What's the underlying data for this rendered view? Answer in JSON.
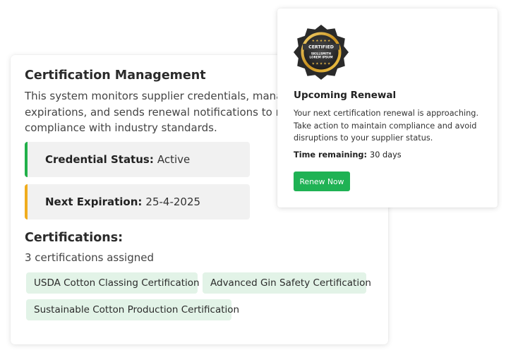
{
  "main": {
    "title": "Certification Management",
    "description_lines": [
      "This system monitors supplier credentials, manages",
      "expirations, and sends renewal notifications to mai",
      "compliance with industry standards."
    ],
    "status": {
      "label": "Credential Status:",
      "value": "Active",
      "accent_color": "#22b04a"
    },
    "expiration": {
      "label": "Next Expiration:",
      "value": "25-4-2025",
      "accent_color": "#f0ad1e"
    },
    "certifications": {
      "heading": "Certifications:",
      "count_text": "3 certifications assigned",
      "tags": [
        "USDA Cotton Classing Certification",
        "Advanced Gin Safety Certification",
        "Sustainable Cotton Production Certification"
      ],
      "tag_color": "#e2f3e7"
    }
  },
  "popup": {
    "badge": {
      "icon": "certified-seal-icon",
      "title": "CERTIFIED",
      "line1": "SKILLSMITH",
      "line2": "LOREM IPSUM",
      "stars": "★ ★ ★ ★ ★"
    },
    "title": "Upcoming Renewal",
    "description_lines": [
      "Your next certification renewal is approaching.",
      "Take action to maintain compliance and avoid",
      "disruptions to your supplier status."
    ],
    "time_label": "Time remaining:",
    "time_value": "30 days",
    "renew_button": "Renew Now",
    "button_color": "#1fb254"
  }
}
